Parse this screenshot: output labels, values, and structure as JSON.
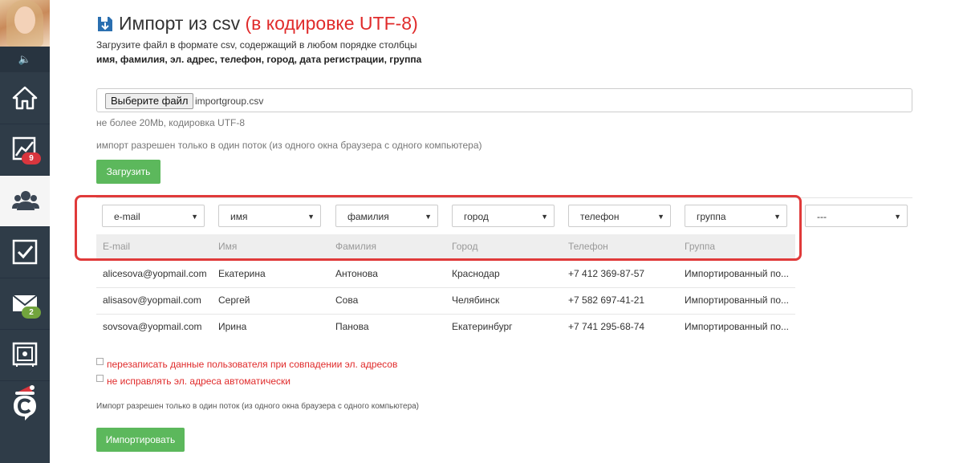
{
  "sidebar": {
    "items": [
      {
        "name": "home",
        "icon": "home-icon"
      },
      {
        "name": "stats",
        "icon": "chart-icon",
        "badge": "9",
        "badge_color": "#d9363e"
      },
      {
        "name": "users",
        "icon": "users-icon"
      },
      {
        "name": "tasks",
        "icon": "checkbox-icon"
      },
      {
        "name": "mail",
        "icon": "mail-icon",
        "badge": "2",
        "badge_color": "#72a43d"
      },
      {
        "name": "safe",
        "icon": "safe-icon"
      },
      {
        "name": "logo",
        "icon": "logo-icon"
      }
    ]
  },
  "header": {
    "title": "Импорт из csv ",
    "title_suffix": "(в кодировке UTF-8)",
    "description": "Загрузите файл в формате csv, содержащий в любом порядке столбцы",
    "columns_text": "имя, фамилия, эл. адрес, телефон, город, дата регистрации, группа"
  },
  "upload": {
    "choose_label": "Выберите файл",
    "file_name": "importgroup.csv",
    "limit_hint": "не более 20Mb, кодировка UTF-8",
    "thread_hint": "импорт разрешен только в один поток (из одного окна браузера с одного компьютера)",
    "upload_button": "Загрузить"
  },
  "mapping": {
    "selects": [
      "e-mail",
      "имя",
      "фамилия",
      "город",
      "телефон",
      "группа",
      "---"
    ]
  },
  "table": {
    "headers": [
      "E-mail",
      "Имя",
      "Фамилия",
      "Город",
      "Телефон",
      "Группа"
    ],
    "rows": [
      [
        "alicesova@yopmail.com",
        "Екатерина",
        "Антонова",
        "Краснодар",
        "+7 412 369-87-57",
        "Импортированный по..."
      ],
      [
        "alisasov@yopmail.com",
        "Сергей",
        "Сова",
        "Челябинск",
        "+7 582 697-41-21",
        "Импортированный по..."
      ],
      [
        "sovsova@yopmail.com",
        "Ирина",
        "Панова",
        "Екатеринбург",
        "+7 741 295-68-74",
        "Импортированный по..."
      ]
    ]
  },
  "options": {
    "overwrite_label": "перезаписать данные пользователя при совпадении эл. адресов",
    "no_fix_label": "не исправлять эл. адреса автоматически"
  },
  "footer": {
    "note": "Импорт разрешен только в один поток (из одного окна браузера с одного компьютера)",
    "import_button": "Импортировать"
  },
  "colors": {
    "accent_green": "#5cb85c",
    "title_red": "#e02b2b",
    "sidebar_bg": "#2f3c48",
    "highlight_red": "#e03a3a"
  }
}
